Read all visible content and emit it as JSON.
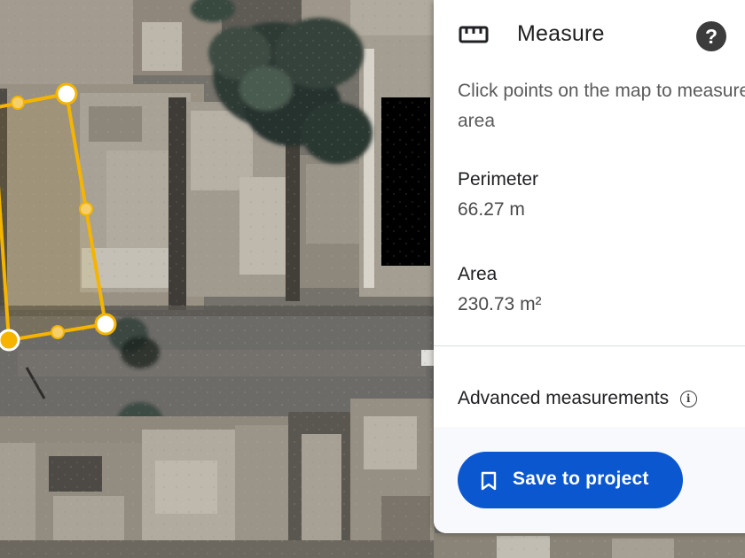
{
  "panel": {
    "title": "Measure",
    "title_icon": "ruler-icon",
    "help_icon": "help-icon",
    "help_glyph": "?",
    "instructions": "Click points on the map to measure area",
    "perimeter": {
      "label": "Perimeter",
      "value": "66.27 m"
    },
    "area": {
      "label": "Area",
      "value": "230.73 m²"
    },
    "advanced": {
      "label": "Advanced measurements",
      "icon": "info-icon",
      "glyph": "i"
    },
    "save_button": {
      "label": "Save to project",
      "icon": "bookmark-icon"
    }
  },
  "map": {
    "view": "satellite imagery",
    "measure_shape": "polygon",
    "measure_color": "#F4B400"
  },
  "colors": {
    "primary": "#0B57D0",
    "panel_bg": "#FFFFFF",
    "footer_bg": "#F7F9FC",
    "text_primary": "#202124",
    "text_secondary": "#5A5A5A"
  }
}
